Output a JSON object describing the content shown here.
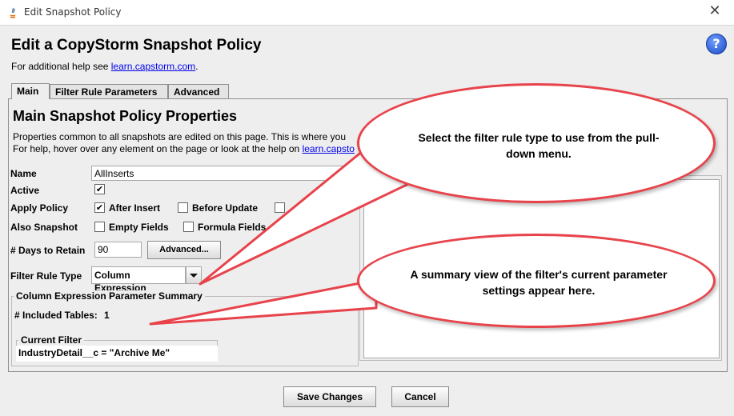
{
  "window": {
    "title": "Edit Snapshot Policy",
    "close_glyph": "✕"
  },
  "header": {
    "title": "Edit a CopyStorm Snapshot Policy",
    "help_prefix": "For additional help see ",
    "help_link": "learn.capstorm.com",
    "help_suffix": ".",
    "help_button": "?"
  },
  "tabs": [
    {
      "label": "Main",
      "active": true
    },
    {
      "label": "Filter Rule Parameters",
      "active": false
    },
    {
      "label": "Advanced",
      "active": false
    }
  ],
  "main": {
    "title": "Main Snapshot Policy Properties",
    "desc_line1": "Properties common to all snapshots are edited on this page. This is where you",
    "desc_line2_prefix": "For help, hover over any element on the page or look at the help on ",
    "desc_line2_link": "learn.capsto",
    "name_label": "Name",
    "name_value": "AllInserts",
    "active_label": "Active",
    "apply_label": "Apply Policy",
    "apply_after_insert": "After Insert",
    "apply_before_update": "Before Update",
    "also_label": "Also Snapshot",
    "also_empty_fields": "Empty Fields",
    "also_formula_fields": "Formula Fields",
    "days_label": "# Days to Retain",
    "days_value": "90",
    "advanced_button": "Advanced...",
    "filter_label": "Filter Rule Type",
    "filter_value": "Column Expression",
    "summary_title": "Column Expression Parameter Summary",
    "included_label": "# Included Tables:",
    "included_value": "1",
    "current_filter_title": "Current Filter",
    "current_filter_value": "IndustryDetail__c = \"Archive Me\""
  },
  "footer": {
    "save": "Save Changes",
    "cancel": "Cancel"
  },
  "callouts": {
    "top": "Select the filter rule type to use from the pull-down menu.",
    "bottom": "A summary view of the filter's current parameter settings appear here."
  },
  "colors": {
    "callout_border": "#e8434b",
    "link": "#0000ee",
    "help_button": "#1a47c4"
  },
  "icons": {
    "app": "java-app-icon",
    "close": "close-icon",
    "help": "help-icon",
    "dropdown": "chevron-down-icon"
  }
}
